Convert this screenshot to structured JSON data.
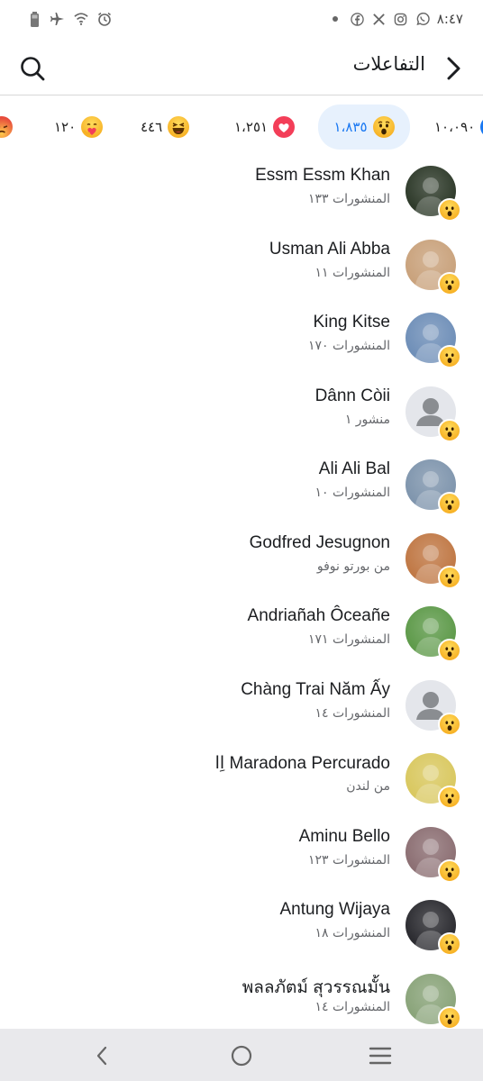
{
  "status_bar": {
    "time": "٨:٤٧",
    "left_icons": [
      "battery-icon",
      "airplane-icon",
      "wifi-icon",
      "alarm-icon"
    ],
    "right_icons": [
      "dot-icon",
      "facebook-icon",
      "x-icon",
      "instagram-icon",
      "whatsapp-icon"
    ]
  },
  "header": {
    "title": "التفاعلات"
  },
  "tabs": [
    {
      "reaction": "like",
      "count": "١٠،٠٩٠"
    },
    {
      "reaction": "wow",
      "count": "١،٨٣٥",
      "active": true
    },
    {
      "reaction": "love",
      "count": "١،٢٥١"
    },
    {
      "reaction": "haha",
      "count": "٤٤٦"
    },
    {
      "reaction": "care",
      "count": "١٢٠"
    },
    {
      "reaction": "angry",
      "count": ""
    }
  ],
  "people": [
    {
      "name": "Essm Essm Khan",
      "subtitle": "المنشورات ١٣٣",
      "avatar_color": "#2e3a2a"
    },
    {
      "name": "Usman Ali Abba",
      "subtitle": "المنشورات ١١",
      "avatar_color": "#c9a27c"
    },
    {
      "name": "King Kitse",
      "subtitle": "المنشورات ١٧٠",
      "avatar_color": "#6f8fb8"
    },
    {
      "name": "Dânn Còii",
      "subtitle": "منشور ١",
      "avatar_color": "",
      "placeholder": true
    },
    {
      "name": "Ali Ali Bal",
      "subtitle": "المنشورات ١٠",
      "avatar_color": "#7f95ad"
    },
    {
      "name": "Godfred Jesugnon",
      "subtitle": "من بورتو نوفو",
      "avatar_color": "#c07845"
    },
    {
      "name": "Andriañah Ôceañe",
      "subtitle": "المنشورات ١٧١",
      "avatar_color": "#5e9a4a"
    },
    {
      "name": "Chàng Trai Năm Ấy",
      "subtitle": "المنشورات ١٤",
      "avatar_color": "",
      "placeholder": true
    },
    {
      "name": "‏اِا Maradona Percurado",
      "subtitle": "من لندن",
      "avatar_color": "#d9c860"
    },
    {
      "name": "Aminu Bello",
      "subtitle": "المنشورات ١٢٣",
      "avatar_color": "#8c6f73"
    },
    {
      "name": "Antung Wijaya",
      "subtitle": "المنشورات ١٨",
      "avatar_color": "#2b2b30"
    },
    {
      "name": "พลลภัตม์ สุวรรณมั้น",
      "subtitle": "المنشورات ١٤",
      "avatar_color": "#8aa47a"
    }
  ],
  "colors": {
    "accent": "#1877f2",
    "active_tab_bg": "#e7f1fd",
    "divider": "#d8d8d8",
    "nav_bg": "#e9e9ec"
  },
  "bottom_nav": [
    "back-nav-icon",
    "home-nav-icon",
    "recents-nav-icon"
  ]
}
